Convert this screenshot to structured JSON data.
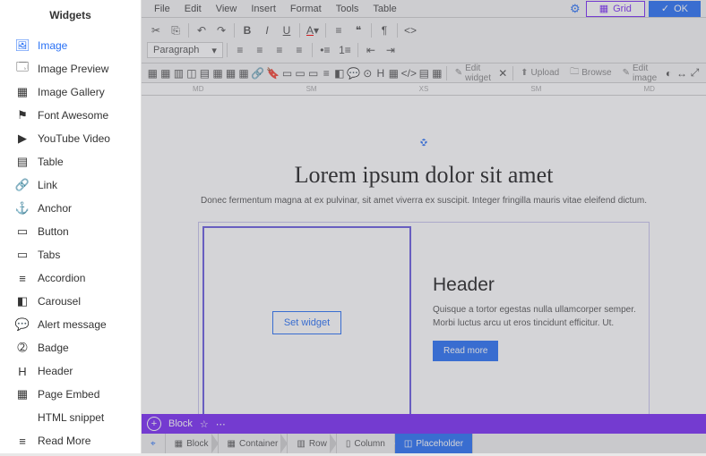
{
  "sidebar": {
    "title": "Widgets",
    "items": [
      {
        "label": "Image",
        "icon": "🖼",
        "active": true
      },
      {
        "label": "Image Preview",
        "icon": "🗔"
      },
      {
        "label": "Image Gallery",
        "icon": "▦"
      },
      {
        "label": "Font Awesome",
        "icon": "⚑"
      },
      {
        "label": "YouTube Video",
        "icon": "▶"
      },
      {
        "label": "Table",
        "icon": "▤"
      },
      {
        "label": "Link",
        "icon": "🔗"
      },
      {
        "label": "Anchor",
        "icon": "⚓"
      },
      {
        "label": "Button",
        "icon": "▭"
      },
      {
        "label": "Tabs",
        "icon": "▭"
      },
      {
        "label": "Accordion",
        "icon": "≡"
      },
      {
        "label": "Carousel",
        "icon": "◧"
      },
      {
        "label": "Alert message",
        "icon": "💬"
      },
      {
        "label": "Badge",
        "icon": "➁"
      },
      {
        "label": "Header",
        "icon": "H"
      },
      {
        "label": "Page Embed",
        "icon": "▦"
      },
      {
        "label": "HTML snippet",
        "icon": "</>"
      },
      {
        "label": "Read More",
        "icon": "≡"
      }
    ]
  },
  "menubar": {
    "items": [
      "File",
      "Edit",
      "View",
      "Insert",
      "Format",
      "Tools",
      "Table"
    ],
    "grid_label": "Grid",
    "ok_label": "OK"
  },
  "toolbar": {
    "paragraph": "Paragraph",
    "third_buttons": {
      "edit_widget": "Edit widget",
      "upload": "Upload",
      "browse": "Browse",
      "edit_image": "Edit image"
    }
  },
  "ruler": [
    "MD",
    "SM",
    "XS",
    "SM",
    "MD"
  ],
  "canvas": {
    "headline": "Lorem ipsum dolor sit amet",
    "subtext": "Donec fermentum magna at ex pulvinar, sit amet viverra ex suscipit. Integer fringilla mauris vitae eleifend dictum.",
    "set_widget": "Set widget",
    "header2": "Header",
    "body2": "Quisque a tortor egestas nulla ullamcorper semper. Morbi luctus arcu ut eros tincidunt efficitur. Ut.",
    "readmore": "Read more"
  },
  "bottombar": {
    "block": "Block"
  },
  "breadcrumb": [
    {
      "label": "Block",
      "icon": "▦"
    },
    {
      "label": "Container",
      "icon": "▦"
    },
    {
      "label": "Row",
      "icon": "▥"
    },
    {
      "label": "Column",
      "icon": "▯"
    },
    {
      "label": "Placeholder",
      "icon": "◫",
      "active": true
    }
  ]
}
